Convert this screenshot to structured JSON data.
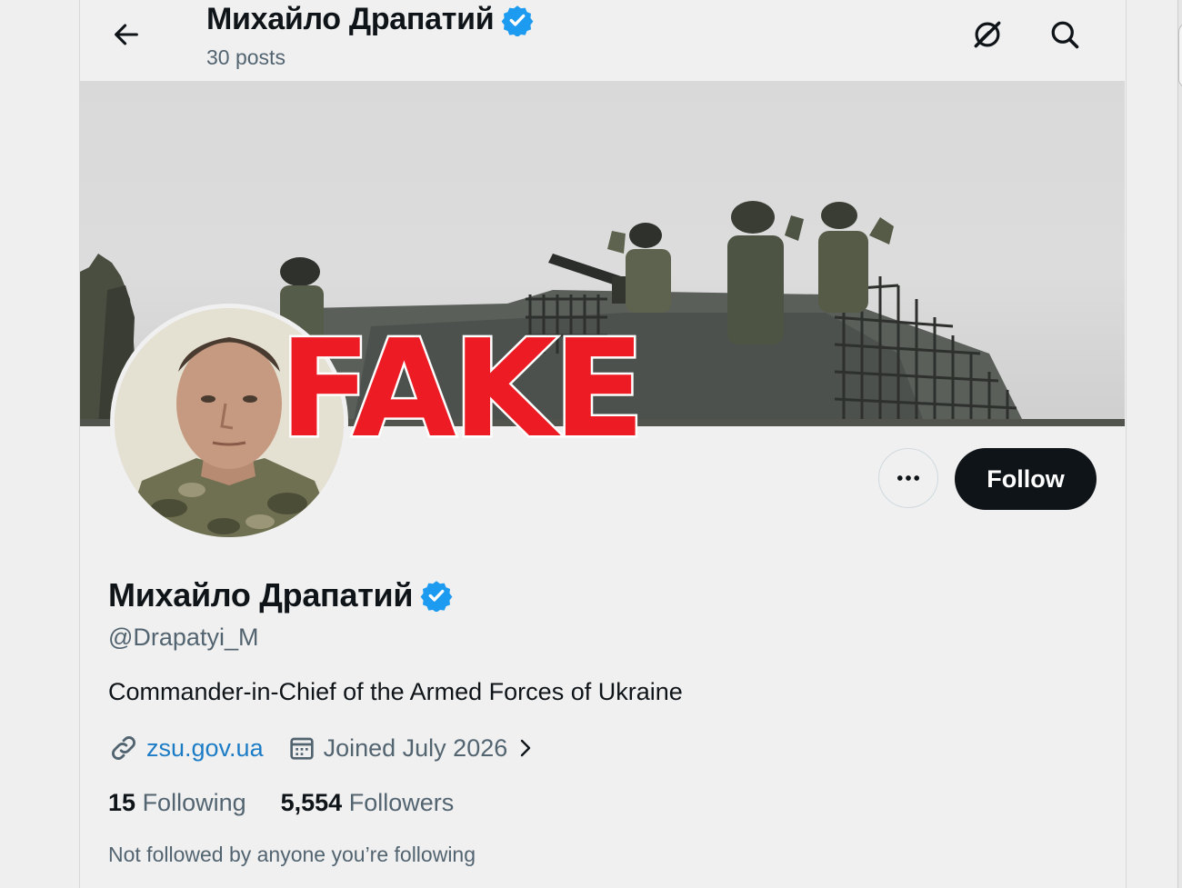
{
  "header": {
    "name": "Михайло Драпатий",
    "posts": "30 posts"
  },
  "stamp": "FAKE",
  "actions": {
    "follow_label": "Follow"
  },
  "profile": {
    "display_name": "Михайло Драпатий",
    "handle": "@Drapatyi_M",
    "bio": "Commander-in-Chief of the Armed Forces of Ukraine",
    "website": "zsu.gov.ua",
    "joined": "Joined July 2026",
    "following_count": "15",
    "following_label": "Following",
    "followers_count": "5,554",
    "followers_label": "Followers",
    "not_followed": "Not followed by anyone you’re following"
  },
  "icons": {
    "back": "arrow-left-icon",
    "grok": "grok-icon",
    "search": "search-icon",
    "more": "more-icon",
    "verified": "verified-badge-icon",
    "link": "link-icon",
    "calendar": "calendar-icon",
    "chevron": "chevron-right-icon"
  },
  "colors": {
    "verified": "#1d9bf0",
    "link": "#1d7cc6",
    "stamp": "#ed1c24",
    "follow_bg": "#0f1419"
  }
}
